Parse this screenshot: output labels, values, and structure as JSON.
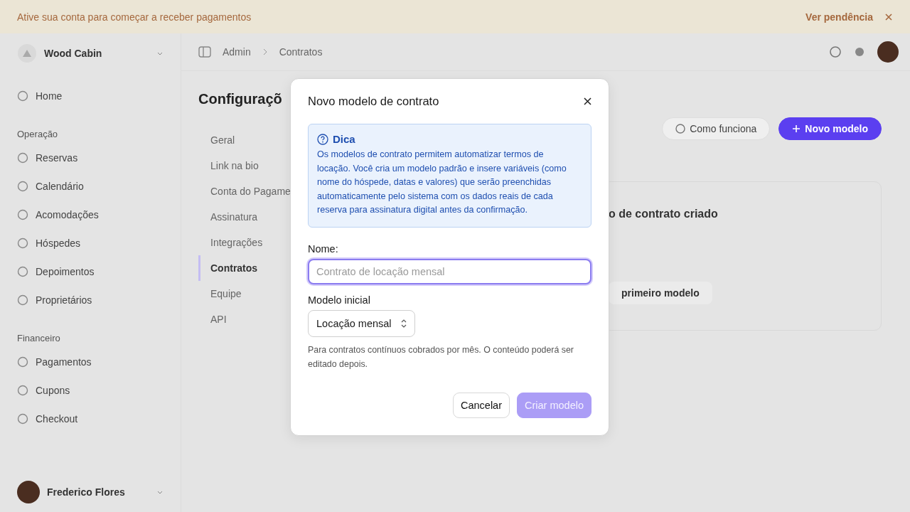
{
  "banner": {
    "message": "Ative sua conta para começar a receber pagamentos",
    "action": "Ver pendência"
  },
  "sidebar": {
    "workspace": {
      "name": "Wood Cabin"
    },
    "sections": [
      {
        "items": [
          {
            "label": "Home"
          }
        ]
      },
      {
        "title": "Operação",
        "items": [
          {
            "label": "Reservas"
          },
          {
            "label": "Calendário"
          },
          {
            "label": "Acomodações"
          },
          {
            "label": "Hóspedes"
          },
          {
            "label": "Depoimentos"
          },
          {
            "label": "Proprietários"
          }
        ]
      },
      {
        "title": "Financeiro",
        "items": [
          {
            "label": "Pagamentos"
          },
          {
            "label": "Cupons"
          },
          {
            "label": "Checkout"
          }
        ]
      }
    ],
    "user": {
      "name": "Frederico Flores"
    }
  },
  "breadcrumb": [
    "Admin",
    "Contratos"
  ],
  "page": {
    "title": "Configuraçõ",
    "settings_nav": [
      {
        "label": "Geral",
        "selected": false
      },
      {
        "label": "Link na bio",
        "selected": false
      },
      {
        "label": "Conta do Pagame",
        "selected": false
      },
      {
        "label": "Assinatura",
        "selected": false
      },
      {
        "label": "Integrações",
        "selected": false
      },
      {
        "label": "Contratos",
        "selected": true
      },
      {
        "label": "Equipe",
        "selected": false
      },
      {
        "label": "API",
        "selected": false
      }
    ],
    "buttons": [
      {
        "label": "Como funciona",
        "kind": "secondary"
      },
      {
        "label": "Novo modelo",
        "kind": "primary"
      }
    ],
    "empty_state": {
      "title": "o de contrato criado",
      "action": "primeiro modelo"
    }
  },
  "dialog": {
    "title": "Novo modelo de contrato",
    "tip": {
      "title": "Dica",
      "text": "Os modelos de contrato permitem automatizar termos de locação. Você cria um modelo padrão e insere variáveis (como nome do hóspede, datas e valores) que serão preenchidas automaticamente pelo sistema com os dados reais de cada reserva para assinatura digital antes da confirmação."
    },
    "name_field": {
      "label": "Nome:",
      "placeholder": "Contrato de locação mensal",
      "focused": true
    },
    "template_field": {
      "label": "Modelo inicial",
      "value": "Locação mensal",
      "help": "Para contratos contínuos cobrados por mês. O conteúdo poderá ser editado depois."
    },
    "buttons": [
      {
        "label": "Cancelar",
        "kind": "secondary",
        "disabled": false
      },
      {
        "label": "Criar modelo",
        "kind": "primary",
        "disabled": true
      }
    ]
  }
}
